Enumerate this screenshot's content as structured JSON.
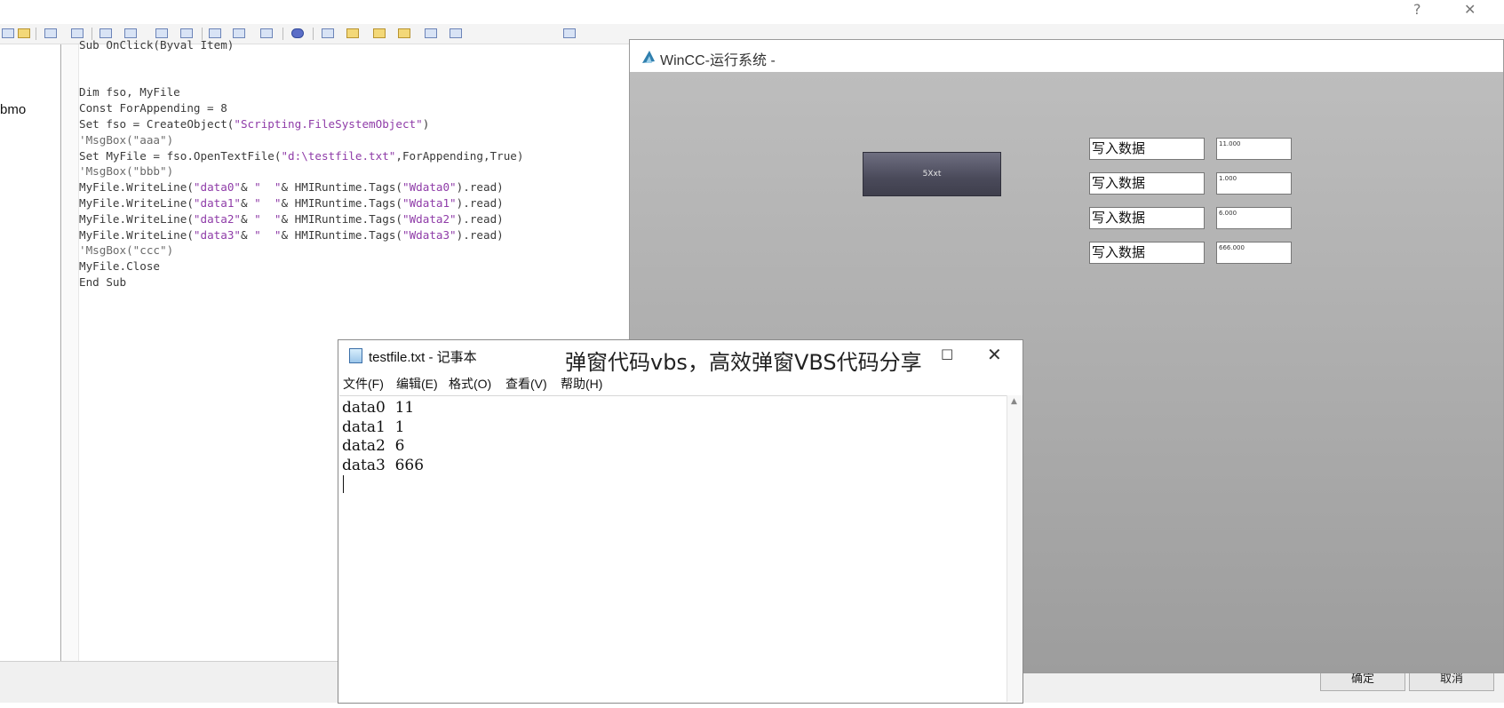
{
  "dialog": {
    "help_glyph": "?",
    "close_glyph": "✕",
    "ok_label": "确定",
    "cancel_label": "取消"
  },
  "tree": {
    "visible_text": "bmo"
  },
  "code_editor": {
    "lines": [
      "Sub OnClick(Byval Item)",
      "",
      "",
      "Dim fso, MyFile",
      "Const ForAppending = 8",
      "Set fso = CreateObject(\"Scripting.FileSystemObject\")",
      "'MsgBox(\"aaa\")",
      "Set MyFile = fso.OpenTextFile(\"d:\\testfile.txt\",ForAppending,True)",
      "'MsgBox(\"bbb\")",
      "MyFile.WriteLine(\"data0\"& \"  \"& HMIRuntime.Tags(\"Wdata0\").read)",
      "MyFile.WriteLine(\"data1\"& \"  \"& HMIRuntime.Tags(\"Wdata1\").read)",
      "MyFile.WriteLine(\"data2\"& \"  \"& HMIRuntime.Tags(\"Wdata2\").read)",
      "MyFile.WriteLine(\"data3\"& \"  \"& HMIRuntime.Tags(\"Wdata3\").read)",
      "'MsgBox(\"ccc\")",
      "MyFile.Close",
      "End Sub"
    ]
  },
  "wincc": {
    "title": "WinCC-运行系统 -",
    "button_label": "5Xxt",
    "rows": [
      {
        "label": "写入数据",
        "value": "11.000"
      },
      {
        "label": "写入数据",
        "value": "1.000"
      },
      {
        "label": "写入数据",
        "value": "6.000"
      },
      {
        "label": "写入数据",
        "value": "666.000"
      }
    ]
  },
  "notepad": {
    "title": "testfile.txt - 记事本",
    "maximize_glyph": "□",
    "close_glyph": "✕",
    "menu": [
      "文件(F)",
      "编辑(E)",
      "格式(O)",
      "查看(V)",
      "帮助(H)"
    ],
    "content": [
      "data0  11",
      "data1  1",
      "data2  6",
      "data3  666"
    ]
  },
  "caption": "弹窗代码vbs，高效弹窗VBS代码分享",
  "colors": {
    "code_string": "#8f3ca8",
    "wincc_canvas": "#ababab",
    "wincc_button": "#4a4a5a"
  }
}
